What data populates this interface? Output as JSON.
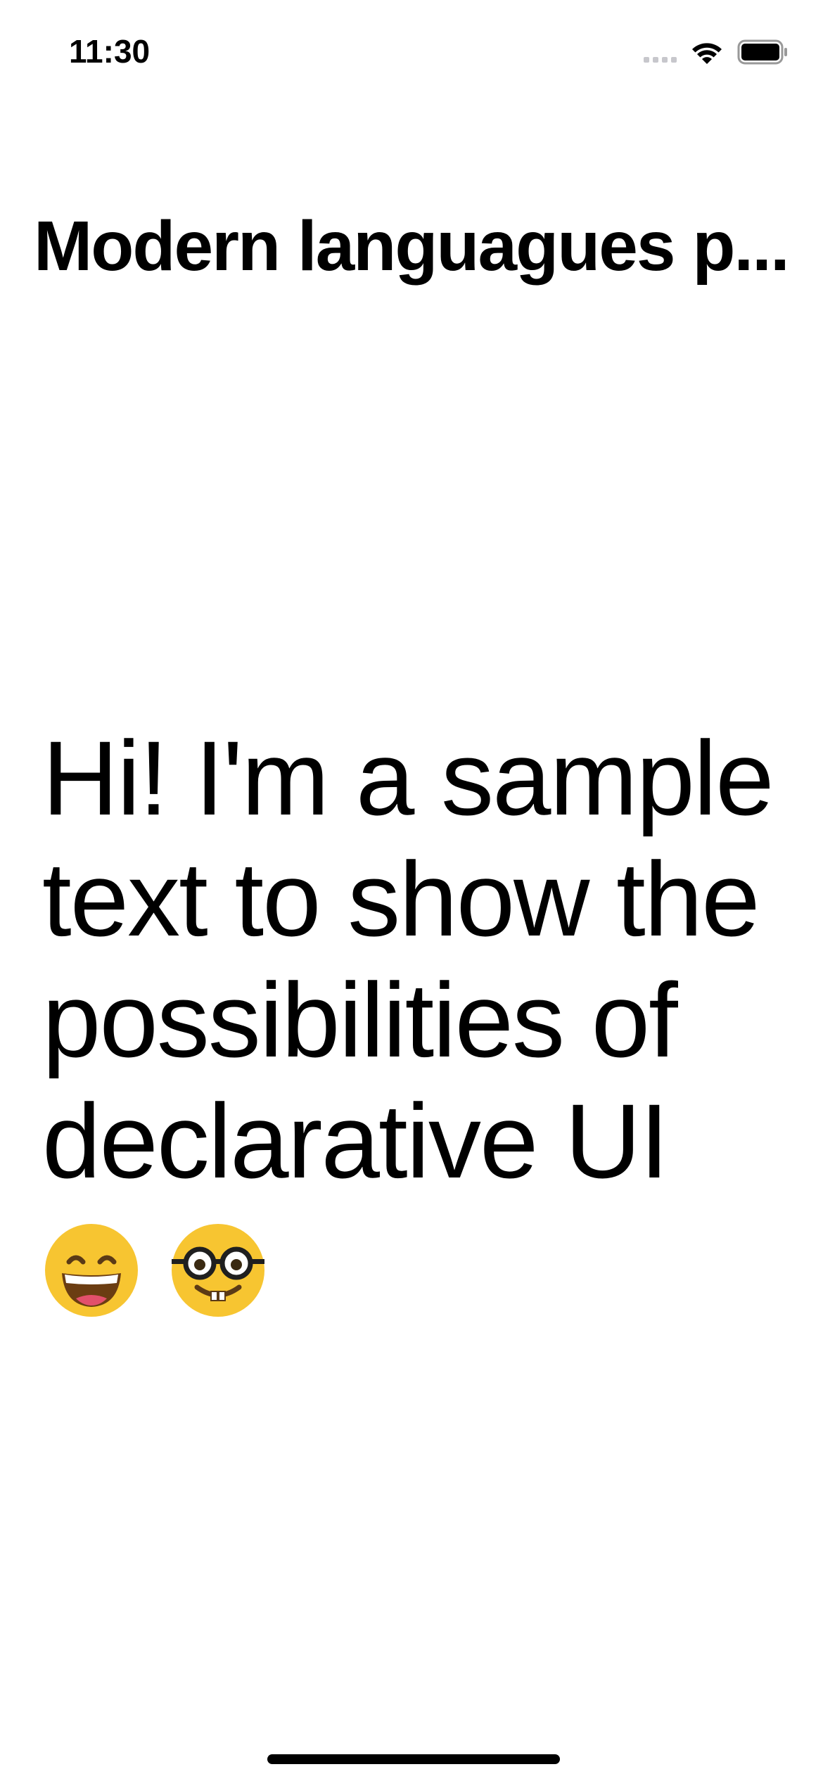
{
  "status_bar": {
    "time": "11:30",
    "icons": [
      "cellular-signal-icon",
      "wifi-icon",
      "battery-icon"
    ]
  },
  "navigation": {
    "title": "Modern languagues p..."
  },
  "content": {
    "text": "Hi! I'm a sample text to show the possibilities of declarative UI",
    "emojis": [
      "grinning-face-with-smiling-eyes",
      "nerd-face"
    ]
  },
  "colors": {
    "background": "#ffffff",
    "text": "#000000",
    "inactive_signal": "#c7c7cc",
    "emoji_yellow": "#f7c531"
  }
}
